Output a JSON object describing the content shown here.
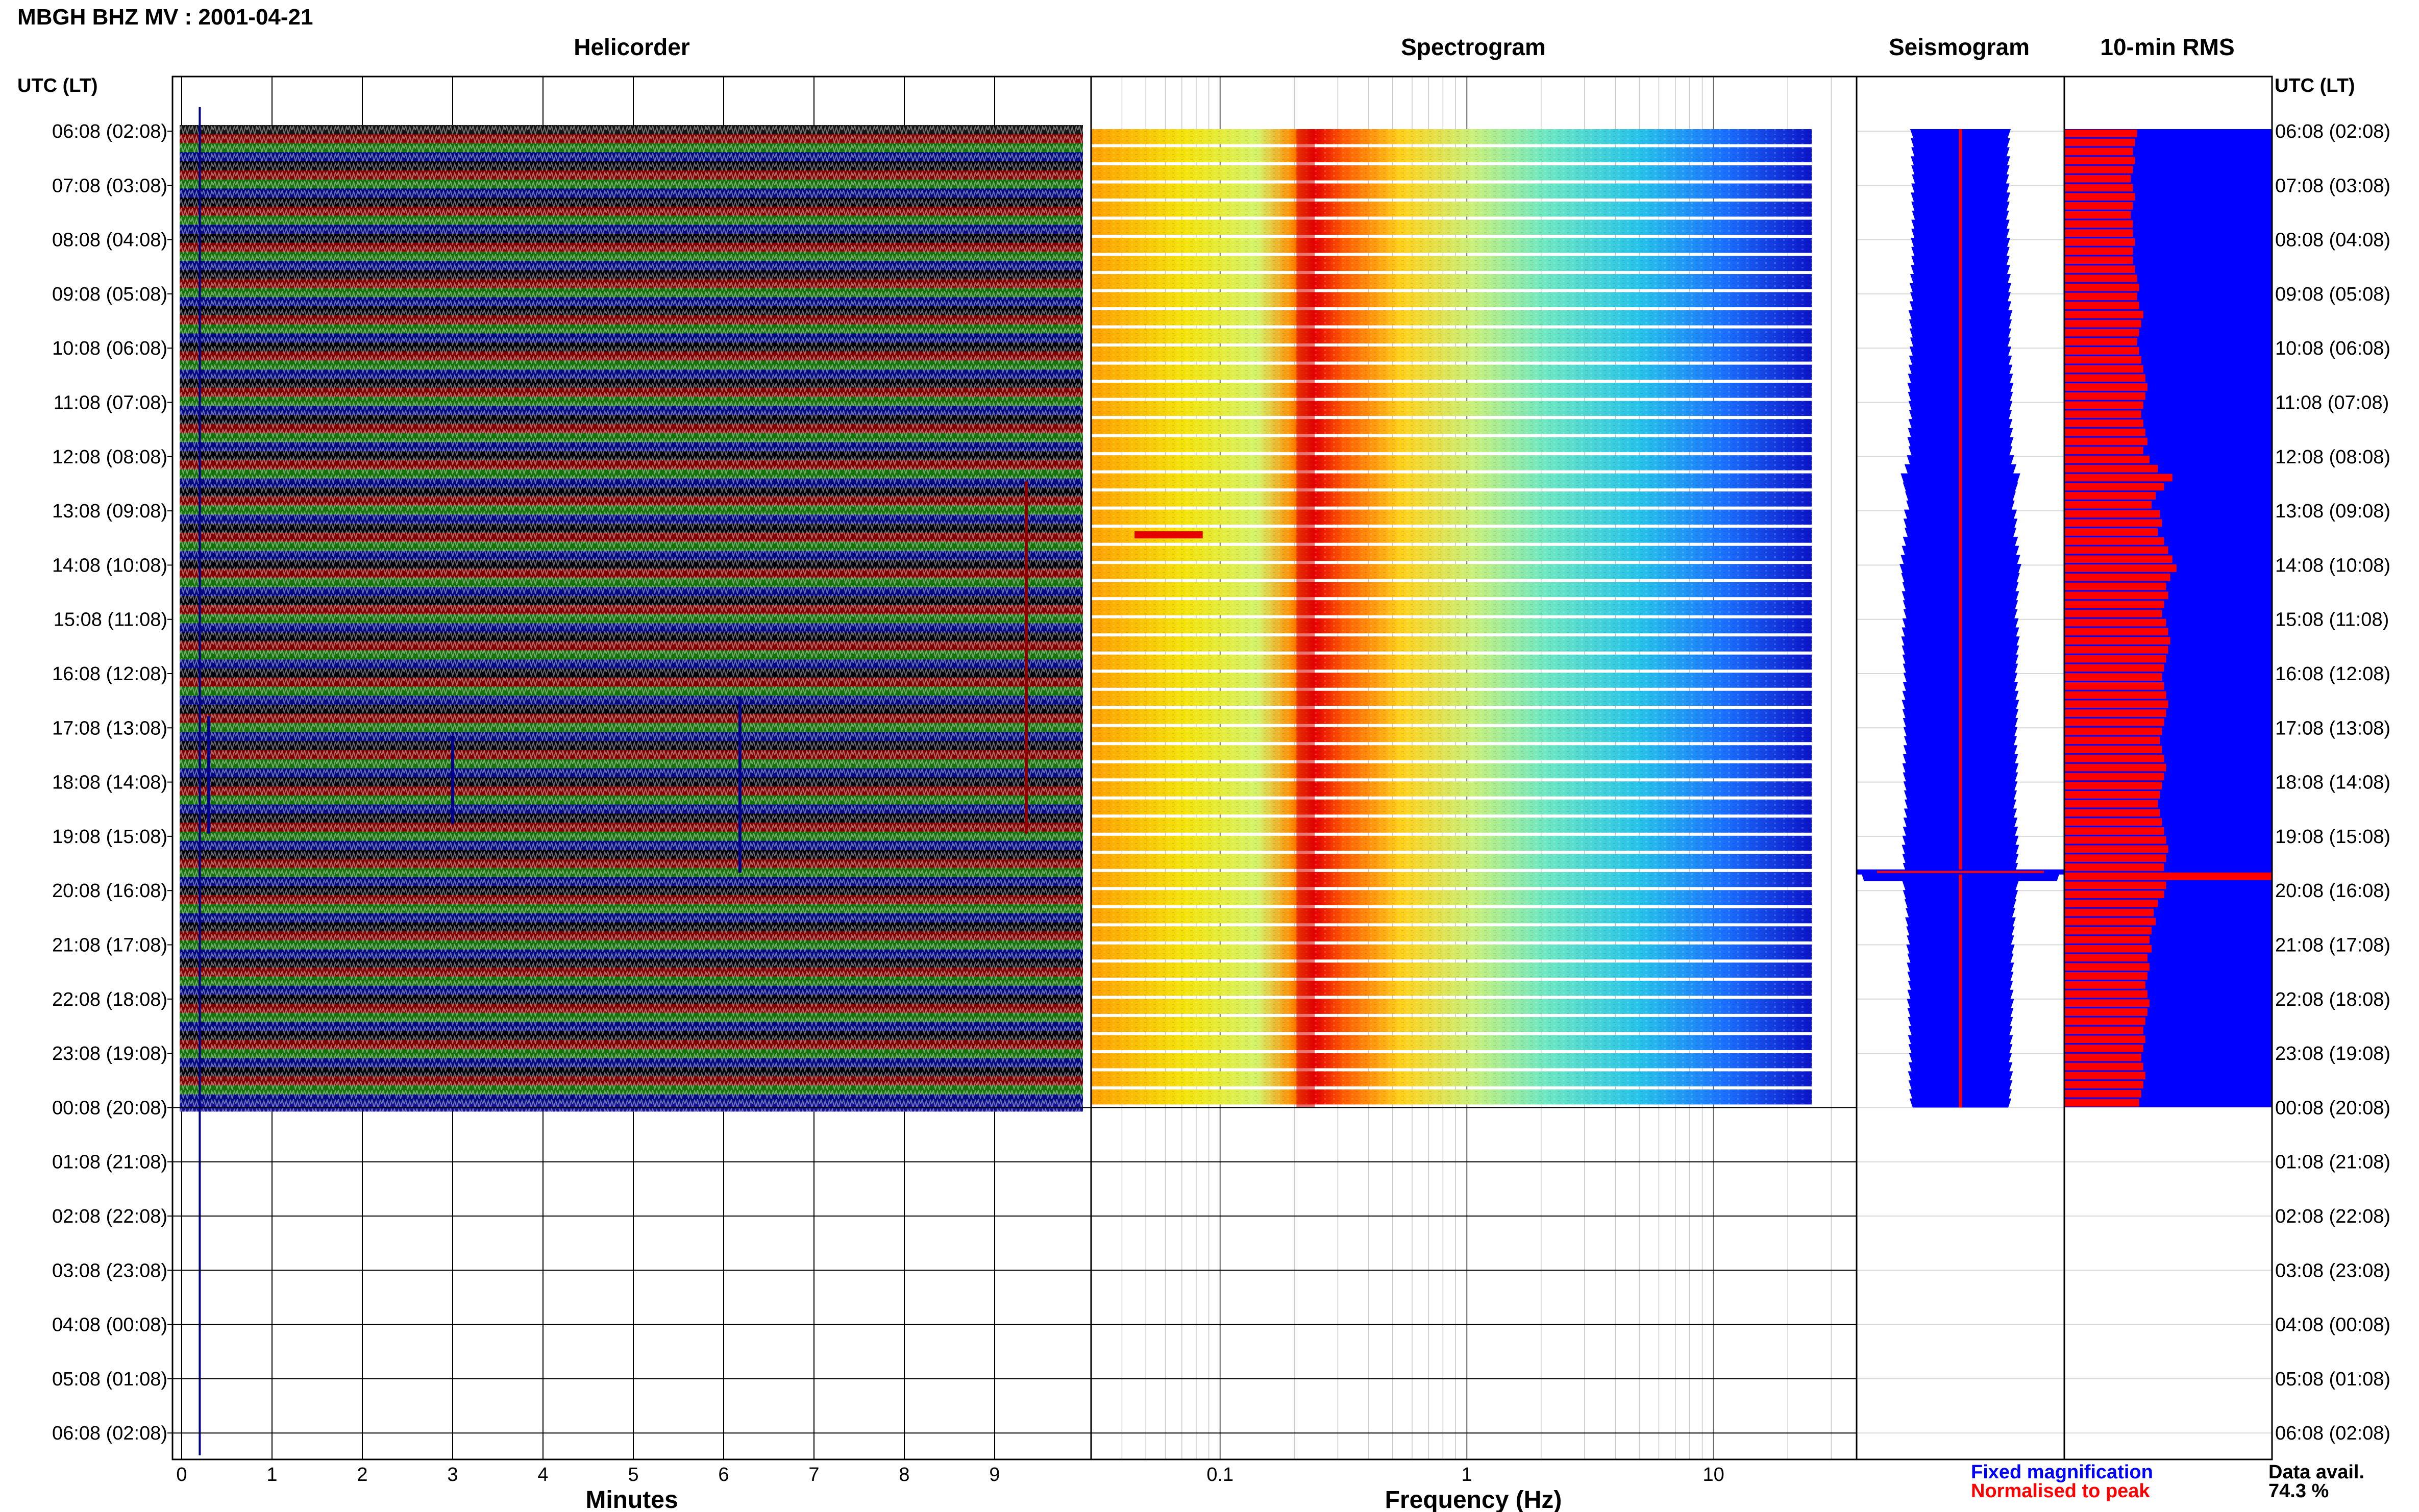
{
  "header": {
    "station_title": "MBGH BHZ MV : 2001-04-21",
    "time_axis_label": "UTC (LT)"
  },
  "panels": {
    "helicorder": {
      "title": "Helicorder",
      "xlabel": "Minutes"
    },
    "spectrogram": {
      "title": "Spectrogram",
      "xlabel": "Frequency (Hz)"
    },
    "seismogram": {
      "title": "Seismogram"
    },
    "rms": {
      "title": "10-min RMS"
    }
  },
  "legend": {
    "fixed_magnification": "Fixed magnification",
    "normalised_to_peak": "Normalised to peak",
    "data_avail_label": "Data avail.",
    "data_avail_value": "74.3 %"
  },
  "colors": {
    "helicorder_traces": [
      "#000000",
      "#8b0000",
      "#0a7a0a",
      "#00008b"
    ],
    "fixed": "#0000ff",
    "normalised": "#ff0000",
    "spectrogram_scale": [
      "#00008b",
      "#1a6bff",
      "#25c8e8",
      "#a8f0a0",
      "#f4f40a",
      "#ff9a00",
      "#e60000"
    ]
  },
  "chart_data": {
    "type": "table",
    "time_ticks": [
      "06:08 (02:08)",
      "07:08 (03:08)",
      "08:08 (04:08)",
      "09:08 (05:08)",
      "10:08 (06:08)",
      "11:08 (07:08)",
      "12:08 (08:08)",
      "13:08 (09:08)",
      "14:08 (10:08)",
      "15:08 (11:08)",
      "16:08 (12:08)",
      "17:08 (13:08)",
      "18:08 (14:08)",
      "19:08 (15:08)",
      "20:08 (16:08)",
      "21:08 (17:08)",
      "22:08 (18:08)",
      "23:08 (19:08)",
      "00:08 (20:08)",
      "01:08 (21:08)",
      "02:08 (22:08)",
      "03:08 (23:08)",
      "04:08 (00:08)",
      "05:08 (01:08)",
      "06:08 (02:08)"
    ],
    "hours_with_data": 18,
    "helicorder_minutes_ticks": [
      "0",
      "1",
      "2",
      "3",
      "4",
      "5",
      "6",
      "7",
      "8",
      "9"
    ],
    "helicorder_xlim": [
      0,
      10
    ],
    "spectrogram_freq_ticks": [
      "0.1",
      "1",
      "10"
    ],
    "spectrogram_freq_tick_values": [
      0.1,
      1,
      10
    ],
    "spectrogram_xlim_hz": [
      0.03,
      38
    ],
    "spectrogram_data_max_hz": 25,
    "spectrogram_peak_hz": 0.22,
    "rms_series": {
      "name": "10-min RMS",
      "unit_fraction_of_peak": true,
      "values": [
        0.35,
        0.34,
        0.33,
        0.34,
        0.33,
        0.32,
        0.33,
        0.34,
        0.33,
        0.32,
        0.33,
        0.33,
        0.34,
        0.33,
        0.33,
        0.34,
        0.35,
        0.36,
        0.35,
        0.36,
        0.38,
        0.37,
        0.36,
        0.35,
        0.36,
        0.37,
        0.38,
        0.39,
        0.4,
        0.39,
        0.38,
        0.37,
        0.38,
        0.39,
        0.4,
        0.38,
        0.41,
        0.45,
        0.52,
        0.48,
        0.44,
        0.42,
        0.46,
        0.47,
        0.45,
        0.48,
        0.5,
        0.52,
        0.54,
        0.51,
        0.49,
        0.5,
        0.48,
        0.47,
        0.49,
        0.5,
        0.51,
        0.5,
        0.49,
        0.48,
        0.47,
        0.48,
        0.49,
        0.5,
        0.49,
        0.48,
        0.47,
        0.46,
        0.47,
        0.48,
        0.49,
        0.48,
        0.47,
        0.46,
        0.45,
        0.46,
        0.47,
        0.48,
        0.49,
        0.5,
        0.49,
        0.48,
        1.0,
        0.49,
        0.48,
        0.45,
        0.43,
        0.44,
        0.42,
        0.41,
        0.42,
        0.4,
        0.41,
        0.4,
        0.39,
        0.4,
        0.41,
        0.4,
        0.39,
        0.38,
        0.39,
        0.38,
        0.37,
        0.38,
        0.39,
        0.38,
        0.37,
        0.36
      ]
    }
  }
}
